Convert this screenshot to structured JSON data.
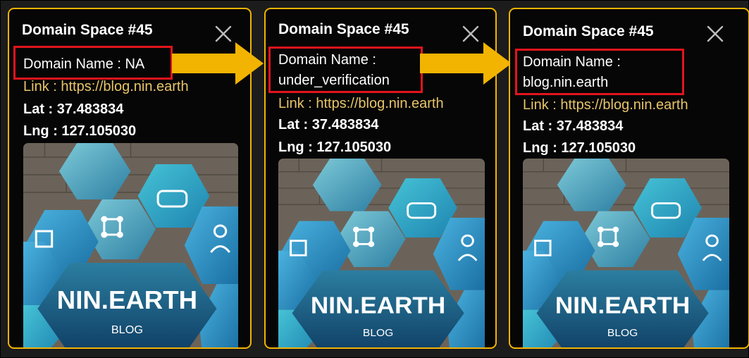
{
  "accent_color": "#f2b400",
  "highlight_color": "#e2141c",
  "link_color": "#e8c46a",
  "panels": [
    {
      "title": "Domain Space #45",
      "domain_name_lines": [
        "Domain Name : NA"
      ],
      "link": "Link : https://blog.nin.earth",
      "lat": "Lat : 37.483834",
      "lng": "Lng : 127.105030",
      "close_icon": "close-icon",
      "image": {
        "logo_text": "NIN.EARTH",
        "sub_text": "BLOG"
      }
    },
    {
      "title": "Domain Space #45",
      "domain_name_lines": [
        "Domain Name :",
        "under_verification"
      ],
      "link": "Link : https://blog.nin.earth",
      "lat": "Lat : 37.483834",
      "lng": "Lng : 127.105030",
      "close_icon": "close-icon",
      "image": {
        "logo_text": "NIN.EARTH",
        "sub_text": "BLOG"
      }
    },
    {
      "title": "Domain Space #45",
      "domain_name_lines": [
        "Domain Name :",
        "blog.nin.earth"
      ],
      "link": "Link : https://blog.nin.earth",
      "lat": "Lat : 37.483834",
      "lng": "Lng : 127.105030",
      "close_icon": "close-icon",
      "image": {
        "logo_text": "NIN.EARTH",
        "sub_text": "BLOG"
      }
    }
  ],
  "arrows": [
    "arrow-right-icon",
    "arrow-right-icon"
  ]
}
